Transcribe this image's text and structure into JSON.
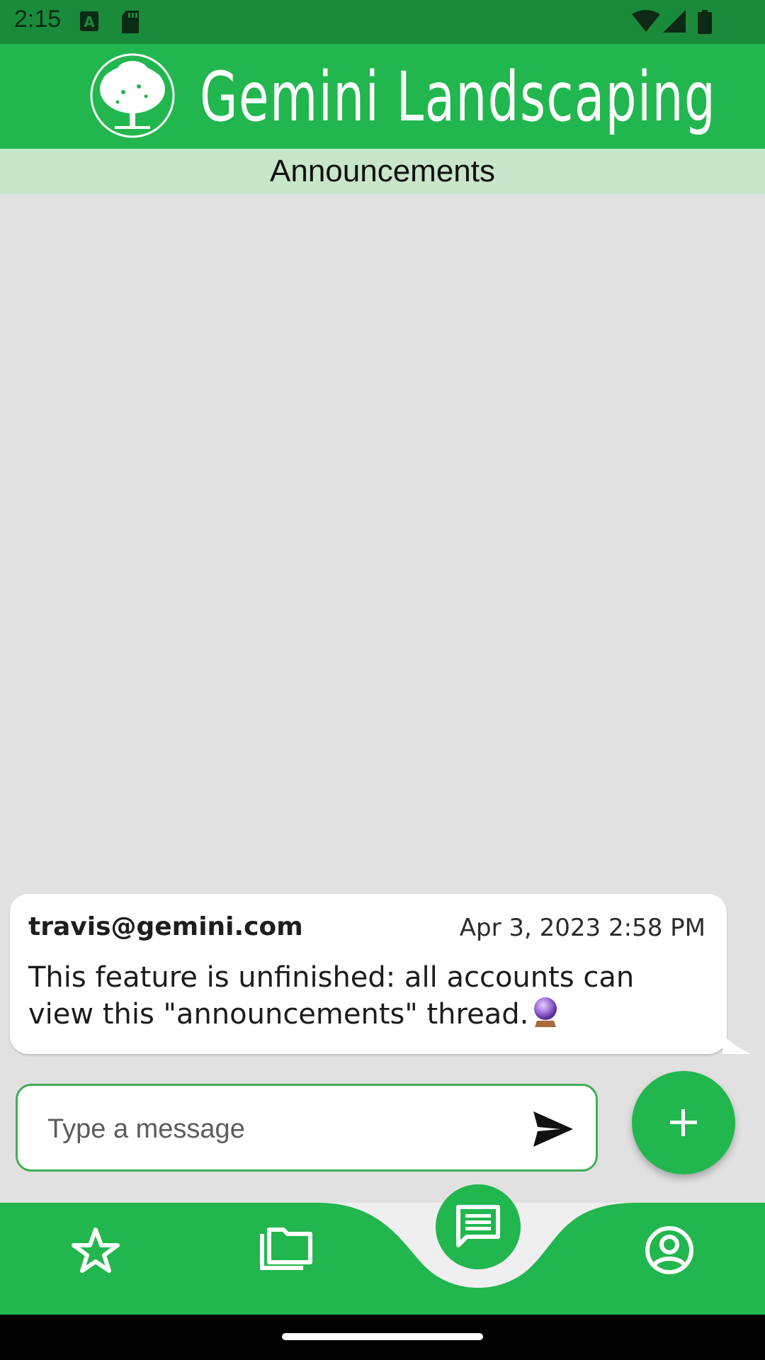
{
  "status_bar": {
    "time": "2:15",
    "icons": [
      "a-notification-icon",
      "sd-card-icon",
      "wifi-icon",
      "cell-signal-icon",
      "battery-icon"
    ]
  },
  "header": {
    "app_title": "Gemini Landscaping",
    "logo_icon": "tree-logo-icon",
    "color": "#21b74e"
  },
  "thread": {
    "title": "Announcements"
  },
  "messages": [
    {
      "author": "travis@gemini.com",
      "timestamp": "Apr 3, 2023 2:58 PM",
      "text": "This feature is unfinished: all accounts can view this \"announcements\" thread.",
      "emoji_icon": "crystal-ball-icon"
    }
  ],
  "composer": {
    "placeholder": "Type a message",
    "send_icon": "send-icon"
  },
  "fab": {
    "icon": "plus-icon"
  },
  "bottom_nav": {
    "items": [
      {
        "icon": "star-icon"
      },
      {
        "icon": "folder-icon"
      },
      {
        "icon": "chat-icon",
        "selected": true
      },
      {
        "icon": "account-circle-icon"
      }
    ]
  },
  "colors": {
    "primary": "#21b74e",
    "status_bar": "#1a8a3b",
    "thread_header": "#c8e6c9",
    "background": "#e1e1e1"
  }
}
